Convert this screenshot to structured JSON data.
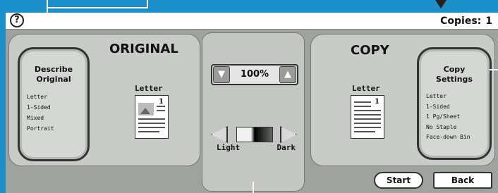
{
  "topbar": {
    "help_glyph": "?",
    "copies_label": "Copies:",
    "copies_value": "1"
  },
  "original": {
    "heading": "ORIGINAL",
    "describe_button": {
      "title_line1": "Describe",
      "title_line2": "Original",
      "lines": [
        "Letter",
        "1-Sided",
        "Mixed",
        "Portrait"
      ]
    },
    "paper_label": "Letter",
    "paper_number": "1"
  },
  "center": {
    "zoom_value": "100%",
    "zoom_down_icon": "triangle-down-icon",
    "zoom_up_icon": "triangle-up-icon",
    "light_label": "Light",
    "dark_label": "Dark"
  },
  "copy": {
    "heading": "COPY",
    "paper_label": "Letter",
    "paper_number": "1",
    "settings_button": {
      "title_line1": "Copy",
      "title_line2": "Settings",
      "lines": [
        "Letter",
        "1-Sided",
        "1 Pg/Sheet",
        "No Staple",
        "Face-down Bin"
      ]
    }
  },
  "actions": {
    "start_label": "Start",
    "back_label": "Back"
  },
  "colors": {
    "background": "#1a8fc9",
    "panel": "#c9cbc9",
    "button_border": "#333333"
  }
}
